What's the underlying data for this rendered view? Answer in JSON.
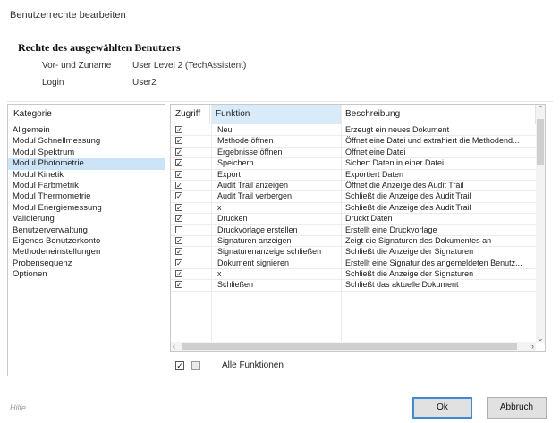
{
  "window": {
    "title": "Benutzerrechte bearbeiten"
  },
  "user_section": {
    "title": "Rechte des ausgewählten Benutzers",
    "name_label": "Vor- und Zuname",
    "name_value": "User Level 2 (TechAssistent)",
    "login_label": "Login",
    "login_value": "User2"
  },
  "categories": {
    "header": "Kategorie",
    "items": [
      {
        "label": "Allgemein",
        "selected": false
      },
      {
        "label": "Modul Schnellmessung",
        "selected": false
      },
      {
        "label": "Modul Spektrum",
        "selected": false
      },
      {
        "label": "Modul Photometrie",
        "selected": true
      },
      {
        "label": "Modul Kinetik",
        "selected": false
      },
      {
        "label": "Modul Farbmetrik",
        "selected": false
      },
      {
        "label": "Modul Thermometrie",
        "selected": false
      },
      {
        "label": "Modul Energiemessung",
        "selected": false
      },
      {
        "label": "Validierung",
        "selected": false
      },
      {
        "label": "Benutzerverwaltung",
        "selected": false
      },
      {
        "label": "Eigenes Benutzerkonto",
        "selected": false
      },
      {
        "label": "Methodeneinstellungen",
        "selected": false
      },
      {
        "label": "Probensequenz",
        "selected": false
      },
      {
        "label": "Optionen",
        "selected": false
      }
    ]
  },
  "grid": {
    "headers": {
      "access": "Zugriff",
      "function": "Funktion",
      "description": "Beschreibung"
    },
    "rows": [
      {
        "checked": true,
        "function": "Neu",
        "description": "Erzeugt ein neues Dokument"
      },
      {
        "checked": true,
        "function": "Methode öffnen",
        "description": "Öffnet eine Datei und extrahiert die Methodend..."
      },
      {
        "checked": true,
        "function": "Ergebnisse öffnen",
        "description": "Öffnet eine Datei"
      },
      {
        "checked": true,
        "function": "Speichern",
        "description": "Sichert Daten in einer Datei"
      },
      {
        "checked": true,
        "function": "Export",
        "description": "Exportiert Daten"
      },
      {
        "checked": true,
        "function": "Audit Trail anzeigen",
        "description": "Öffnet die Anzeige des Audit Trail"
      },
      {
        "checked": true,
        "function": "Audit Trail verbergen",
        "description": "Schließt die Anzeige des Audit Trail"
      },
      {
        "checked": true,
        "function": "x",
        "description": "Schließt die Anzeige des Audit Trail"
      },
      {
        "checked": true,
        "function": "Drucken",
        "description": "Druckt Daten"
      },
      {
        "checked": false,
        "function": "Druckvorlage erstellen",
        "description": "Erstellt eine Druckvorlage"
      },
      {
        "checked": true,
        "function": "Signaturen anzeigen",
        "description": "Zeigt die Signaturen des Dokumentes an"
      },
      {
        "checked": true,
        "function": "Signaturenanzeige schließen",
        "description": "Schließt die Anzeige der Signaturen"
      },
      {
        "checked": true,
        "function": "Dokument signieren",
        "description": "Erstellt eine Signatur des angemeldeten Benutz..."
      },
      {
        "checked": true,
        "function": "x",
        "description": "Schließt die Anzeige der Signaturen"
      },
      {
        "checked": true,
        "function": "Schließen",
        "description": "Schließt das aktuelle Dokument"
      }
    ]
  },
  "footer": {
    "all_functions_label": "Alle Funktionen"
  },
  "help_text": "Hilfe ...",
  "buttons": {
    "ok": "Ok",
    "cancel": "Abbruch"
  }
}
